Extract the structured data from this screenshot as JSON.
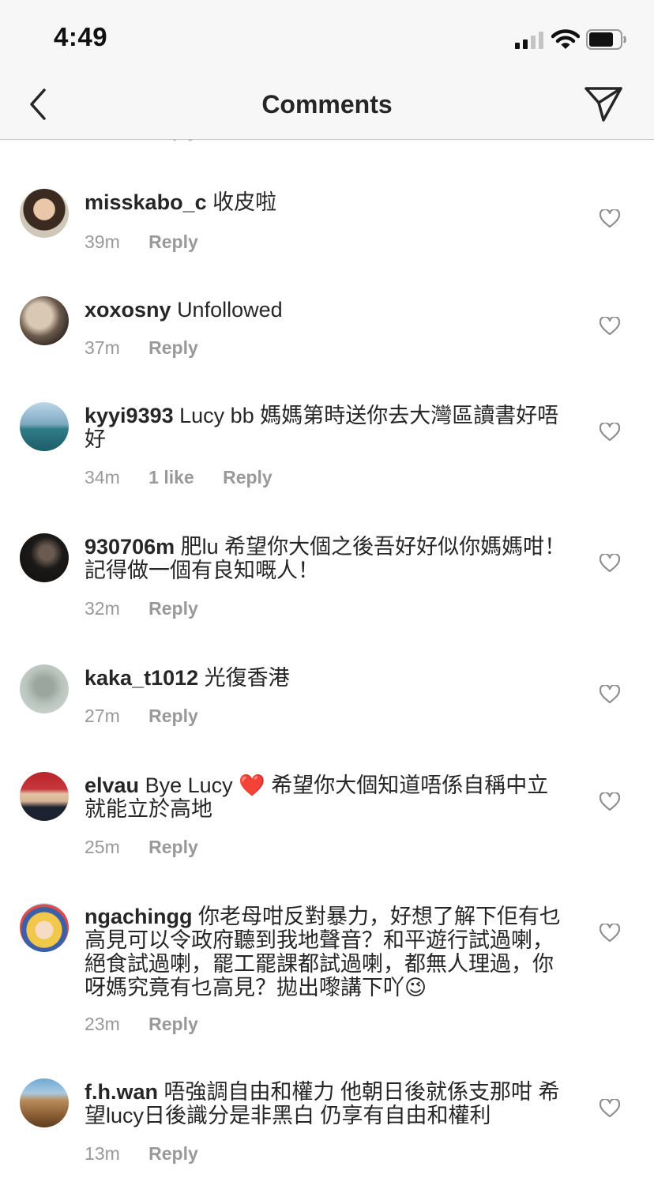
{
  "status": {
    "time": "4:49"
  },
  "header": {
    "title": "Comments"
  },
  "comments": [
    {
      "username": "misskabo_c",
      "text": "收皮啦",
      "time": "39m",
      "likes": "",
      "reply": "Reply"
    },
    {
      "username": "xoxosny",
      "text": "Unfollowed",
      "time": "37m",
      "likes": "",
      "reply": "Reply"
    },
    {
      "username": "kyyi9393",
      "text": "Lucy bb 媽媽第時送你去大灣區讀書好唔好",
      "time": "34m",
      "likes": "1 like",
      "reply": "Reply"
    },
    {
      "username": "930706m",
      "text": "肥lu 希望你大個之後吾好好似你媽媽咁！記得做一個有良知嘅人！",
      "time": "32m",
      "likes": "",
      "reply": "Reply"
    },
    {
      "username": "kaka_t1012",
      "text": "光復香港",
      "time": "27m",
      "likes": "",
      "reply": "Reply"
    },
    {
      "username": "elvau",
      "text": "Bye Lucy ❤️  希望你大個知道唔係自稱中立就能立於高地",
      "time": "25m",
      "likes": "",
      "reply": "Reply"
    },
    {
      "username": "ngachingg",
      "text": "你老母咁反對暴力，好想了解下佢有乜高見可以令政府聽到我地聲音？和平遊行試過喇，絕食試過喇，罷工罷課都試過喇，都無人理過，你呀媽究竟有乜高見？拋出嚟講下吖😉",
      "time": "23m",
      "likes": "",
      "reply": "Reply"
    },
    {
      "username": "f.h.wan",
      "text": "唔強調自由和權力 他朝日後就係支那咁 希望lucy日後識分是非黑白 仍享有自由和權利",
      "time": "13m",
      "likes": "",
      "reply": "Reply"
    }
  ],
  "icons": {
    "back": "chevron-left-icon",
    "send": "paper-plane-icon",
    "like": "heart-outline-icon"
  },
  "colors": {
    "text": "#262626",
    "meta": "#999999",
    "bar": "#f7f7f7"
  }
}
